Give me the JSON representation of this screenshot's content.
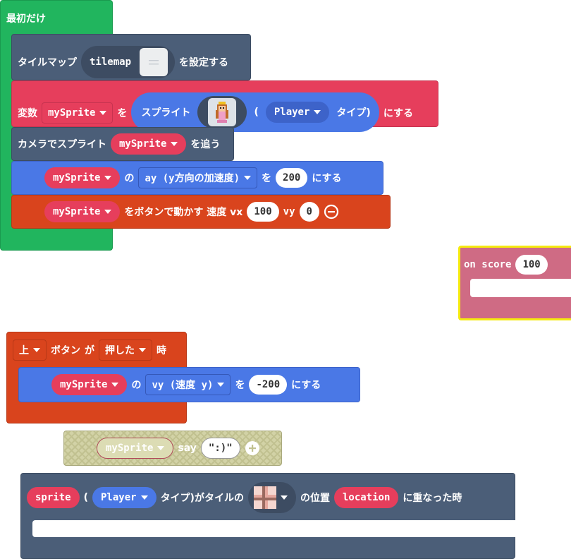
{
  "colors": {
    "loops_green": "#21b55e",
    "scene_navy": "#4b5e78",
    "sprites_red": "#e63e5c",
    "controller_orange": "#d9441d",
    "math_blue": "#4a78e6",
    "info_pink": "#cf6b84",
    "highlight_yellow": "#f5ea0f",
    "disabled_olive": "#c5c59a"
  },
  "on_start": {
    "label": "最初だけ"
  },
  "set_tilemap": {
    "prefix": "タイルマップ",
    "value": "tilemap",
    "suffix": "を設定する",
    "icon": "tilemap-thumbnail-icon"
  },
  "set_variable": {
    "label_variable": "変数",
    "variable": "mySprite",
    "label_to": "を",
    "label_sprite": "スプライト",
    "paren_open": "(",
    "kind": "Player",
    "kind_suffix": "タイプ)",
    "suffix": "にする",
    "icon": "princess-sprite-icon"
  },
  "camera_follow": {
    "prefix": "カメラでスプライト",
    "variable": "mySprite",
    "suffix": "を追う"
  },
  "set_ay": {
    "variable": "mySprite",
    "label_of": "の",
    "property": "ay (y方向の加速度)",
    "label_to": "を",
    "value": "200",
    "suffix": "にする"
  },
  "move_with_buttons": {
    "variable": "mySprite",
    "text": "をボタンで動かす 速度 vx",
    "vx": "100",
    "label_vy": "vy",
    "vy": "0"
  },
  "on_score": {
    "label": "on score",
    "value": "100"
  },
  "button_event": {
    "button": "上",
    "label_button": "ボタン",
    "label_ga": "が",
    "action": "押した",
    "label_when": "時"
  },
  "set_vy": {
    "variable": "mySprite",
    "label_of": "の",
    "property": "vy (速度 y)",
    "label_to": "を",
    "value": "-200",
    "suffix": "にする"
  },
  "say_block": {
    "variable": "mySprite",
    "label": "say",
    "text": "\":)\""
  },
  "overlap_event": {
    "var": "sprite",
    "paren_open": "(",
    "kind": "Player",
    "text_kind": "タイプ)がタイルの",
    "label_position": "の位置",
    "location": "location",
    "suffix": "に重なった時",
    "icon": "tile-thumbnail-icon"
  }
}
